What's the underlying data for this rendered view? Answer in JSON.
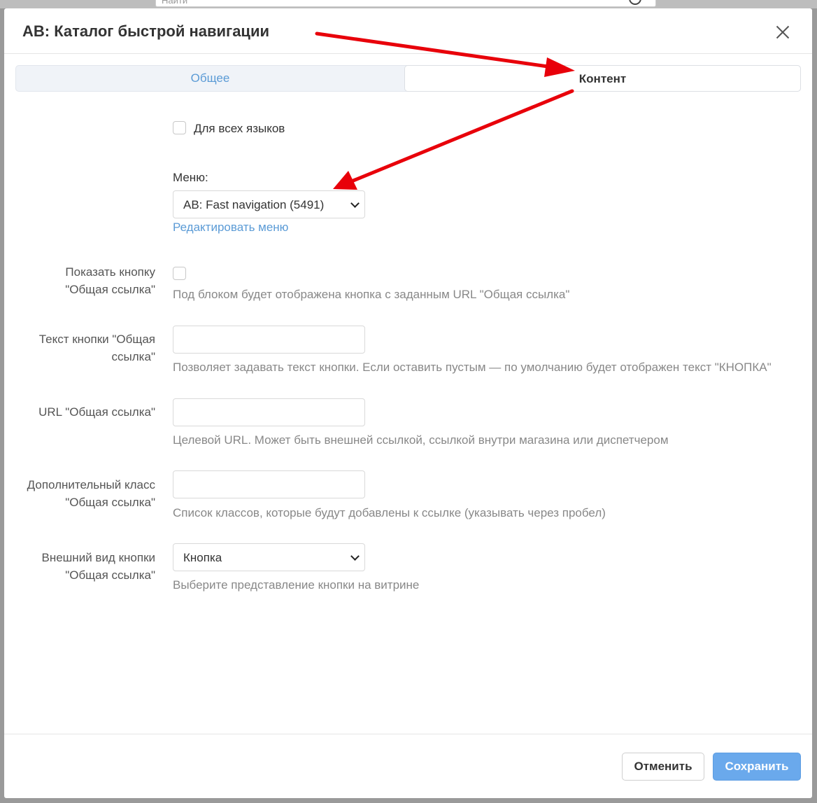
{
  "background": {
    "search_placeholder": "Найти"
  },
  "modal": {
    "title": "AB: Каталог быстрой навигации",
    "tabs": [
      {
        "label": "Общее",
        "active": false
      },
      {
        "label": "Контент",
        "active": true
      }
    ]
  },
  "form": {
    "all_languages": {
      "label": "Для всех языков",
      "checked": false
    },
    "menu": {
      "title": "Меню:",
      "selected": "AB: Fast navigation (5491)",
      "edit_link": "Редактировать меню"
    },
    "show_button": {
      "label_line1": "Показать кнопку",
      "label_line2": "\"Общая ссылка\"",
      "checked": false,
      "hint": "Под блоком будет отображена кнопка с заданным URL \"Общая ссылка\""
    },
    "button_text": {
      "label_line1": "Текст кнопки \"Общая",
      "label_line2": "ссылка\"",
      "value": "",
      "hint": "Позволяет задавать текст кнопки. Если оставить пустым — по умолчанию будет отображен текст \"КНОПКА\""
    },
    "url": {
      "label": "URL \"Общая ссылка\"",
      "value": "",
      "hint": "Целевой URL. Может быть внешней ссылкой, ссылкой внутри магазина или диспетчером"
    },
    "extra_class": {
      "label_line1": "Дополнительный класс",
      "label_line2": "\"Общая ссылка\"",
      "value": "",
      "hint": "Список классов, которые будут добавлены к ссылке (указывать через пробел)"
    },
    "appearance": {
      "label_line1": "Внешний вид кнопки",
      "label_line2": "\"Общая ссылка\"",
      "selected": "Кнопка",
      "hint": "Выберите представление кнопки на витрине"
    }
  },
  "footer": {
    "cancel_label": "Отменить",
    "save_label": "Сохранить"
  },
  "colors": {
    "accent": "#5b9bd6",
    "save_button": "#6aa9ec",
    "annotation_arrow": "#e8000a"
  }
}
